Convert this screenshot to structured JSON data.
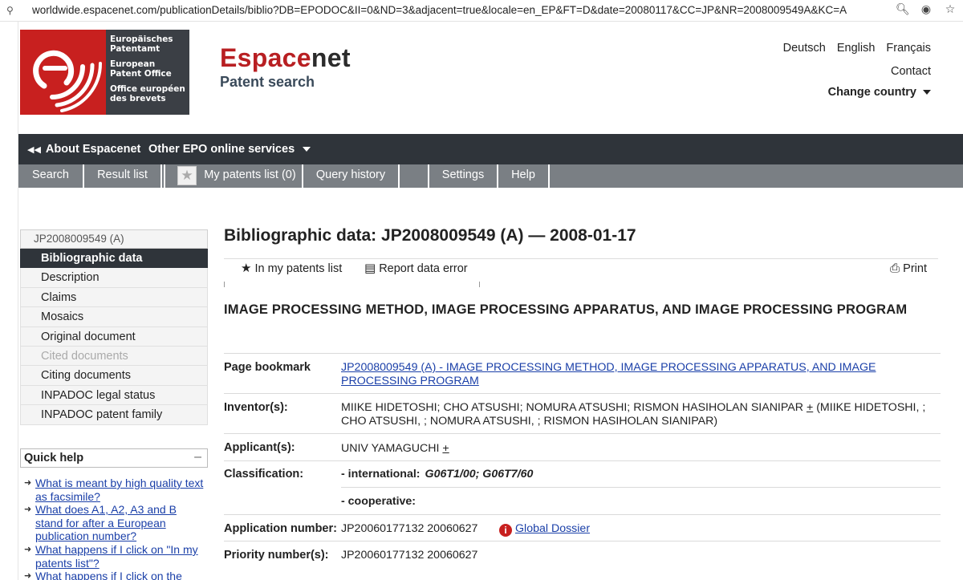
{
  "browser": {
    "url": "worldwide.espacenet.com/publicationDetails/biblio?DB=EPODOC&II=0&ND=3&adjacent=true&locale=en_EP&FT=D&date=20080117&CC=JP&NR=2008009549A&KC=A"
  },
  "header": {
    "logo_lines": [
      "Europäisches Patentamt",
      "European Patent Office",
      "Office européen des brevets"
    ],
    "brand_part1": "Espace",
    "brand_part2": "net",
    "brand_sub": "Patent search",
    "languages": [
      "Deutsch",
      "English",
      "Français"
    ],
    "contact": "Contact",
    "change_country": "Change country"
  },
  "topnav": {
    "about": "About Espacenet",
    "other": "Other EPO online services"
  },
  "tabs": {
    "search": "Search",
    "result_list": "Result list",
    "my_patents": "My patents list (0)",
    "query_history": "Query history",
    "settings": "Settings",
    "help": "Help"
  },
  "sidebar": {
    "doc_id": "JP2008009549 (A)",
    "items": [
      {
        "label": "Bibliographic data",
        "state": "active"
      },
      {
        "label": "Description",
        "state": "normal"
      },
      {
        "label": "Claims",
        "state": "normal"
      },
      {
        "label": "Mosaics",
        "state": "normal"
      },
      {
        "label": "Original document",
        "state": "normal"
      },
      {
        "label": "Cited documents",
        "state": "disabled"
      },
      {
        "label": "Citing documents",
        "state": "normal"
      },
      {
        "label": "INPADOC legal status",
        "state": "normal"
      },
      {
        "label": "INPADOC patent family",
        "state": "normal"
      }
    ]
  },
  "quick_help": {
    "title": "Quick help",
    "collapse": "–",
    "links": [
      "What is meant by high quality text as facsimile?",
      "What does A1, A2, A3 and B stand for after a European publication number?",
      "What happens if I click on \"In my patents list\"?",
      "What happens if I click on the"
    ]
  },
  "main": {
    "title": "Bibliographic data: JP2008009549 (A) — 2008-01-17",
    "actions": {
      "in_my_patents": "In my patents list",
      "report_error": "Report data error",
      "print": "Print"
    },
    "doc_title": "IMAGE PROCESSING METHOD, IMAGE PROCESSING APPARATUS, AND IMAGE PROCESSING PROGRAM",
    "fields": {
      "page_bookmark_label": "Page bookmark",
      "page_bookmark_value": "JP2008009549 (A)  -  IMAGE PROCESSING METHOD, IMAGE PROCESSING APPARATUS, AND IMAGE PROCESSING PROGRAM",
      "inventors_label": "Inventor(s):",
      "inventors_value": "MIIKE HIDETOSHI; CHO ATSUSHI; NOMURA ATSUSHI; RISMON HASIHOLAN SIANIPAR",
      "inventors_plus": "+",
      "inventors_alt": "(MIIKE HIDETOSHI, ; CHO ATSUSHI, ; NOMURA ATSUSHI, ; RISMON HASIHOLAN SIANIPAR)",
      "applicants_label": "Applicant(s):",
      "applicants_value": "UNIV YAMAGUCHI",
      "applicants_plus": "+",
      "classification_label": "Classification:",
      "class_international_label": "- international:",
      "class_international_value": "G06T1/00; G06T7/60",
      "class_cooperative_label": "- cooperative:",
      "application_number_label": "Application number:",
      "application_number_value": "JP20060177132 20060627",
      "global_dossier": "Global Dossier",
      "priority_number_label": "Priority number(s):",
      "priority_number_value": "JP20060177132 20060627"
    }
  }
}
